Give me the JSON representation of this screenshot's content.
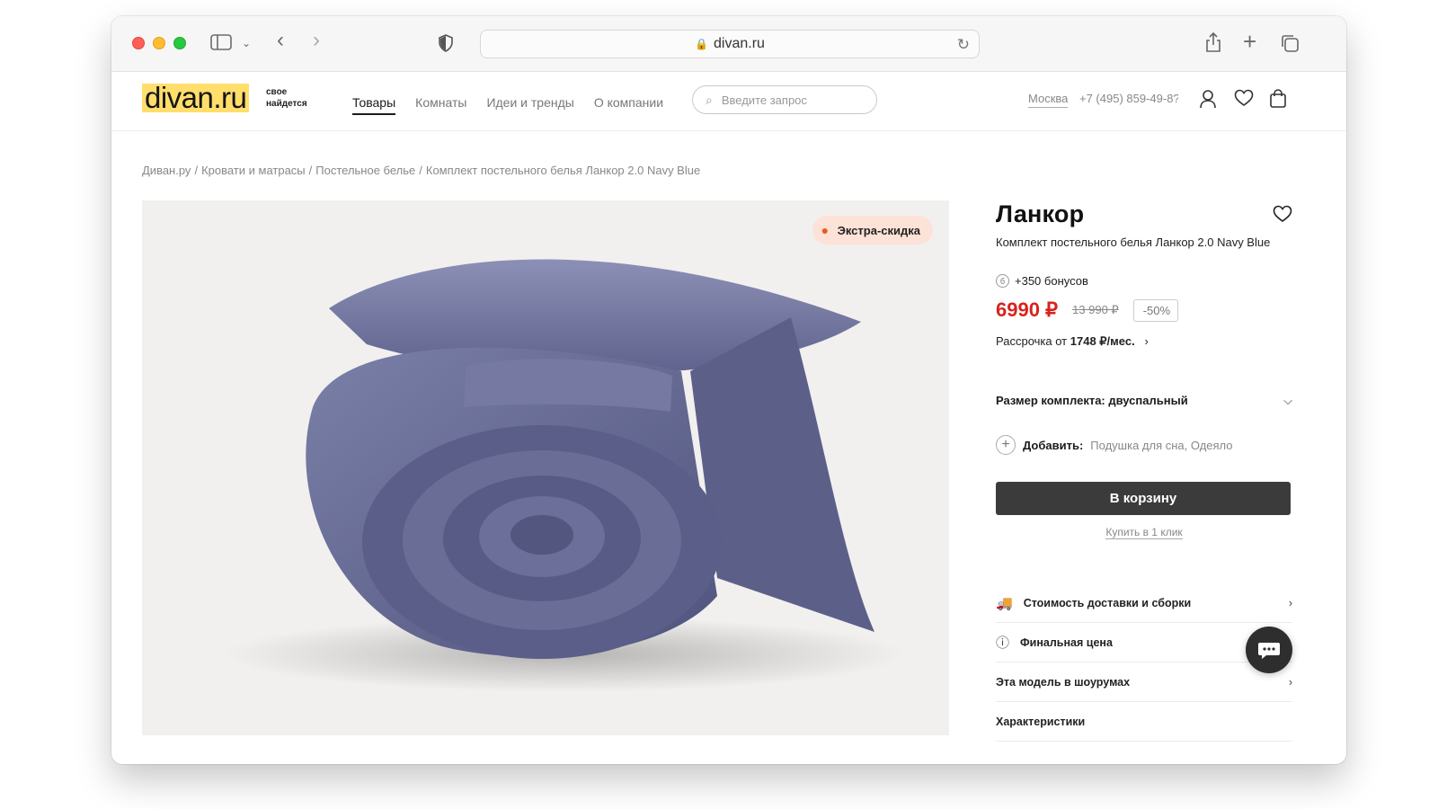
{
  "browser": {
    "url": "divan.ru"
  },
  "header": {
    "logo": "divan.ru",
    "tagline_1": "свое",
    "tagline_2": "найдется",
    "nav": [
      "Товары",
      "Комнаты",
      "Идеи и тренды",
      "О компании"
    ],
    "search_placeholder": "Введите запрос",
    "city": "Москва",
    "phone": "+7 (495) 859-49-8?"
  },
  "breadcrumb": [
    "Диван.ру",
    "Кровати и матрасы",
    "Постельное белье",
    "Комплект постельного белья Ланкор 2.0 Navy Blue"
  ],
  "product": {
    "badge": "Экстра-скидка",
    "title": "Ланкор",
    "subtitle": "Комплект постельного белья Ланкор 2.0 Navy Blue",
    "bonus": "+350 бонусов",
    "price": "6990 ₽",
    "old_price": "13 990 ₽",
    "discount": "-50%",
    "installment_prefix": "Рассрочка от ",
    "installment_value": "1748 ₽/мес.",
    "size_label": "Размер комплекта: двуспальный",
    "add_label": "Добавить:",
    "add_items": "Подушка для сна, Одеяло",
    "cart_button": "В корзину",
    "one_click": "Купить в 1 клик",
    "info": [
      "Стоимость доставки и сборки",
      "Финальная цена",
      "Эта модель в шоурумах",
      "Характеристики"
    ]
  },
  "colors": {
    "price_red": "#d8231d",
    "logo_yellow": "#ffde6b",
    "bedding_blue": "#6b6f9a"
  }
}
